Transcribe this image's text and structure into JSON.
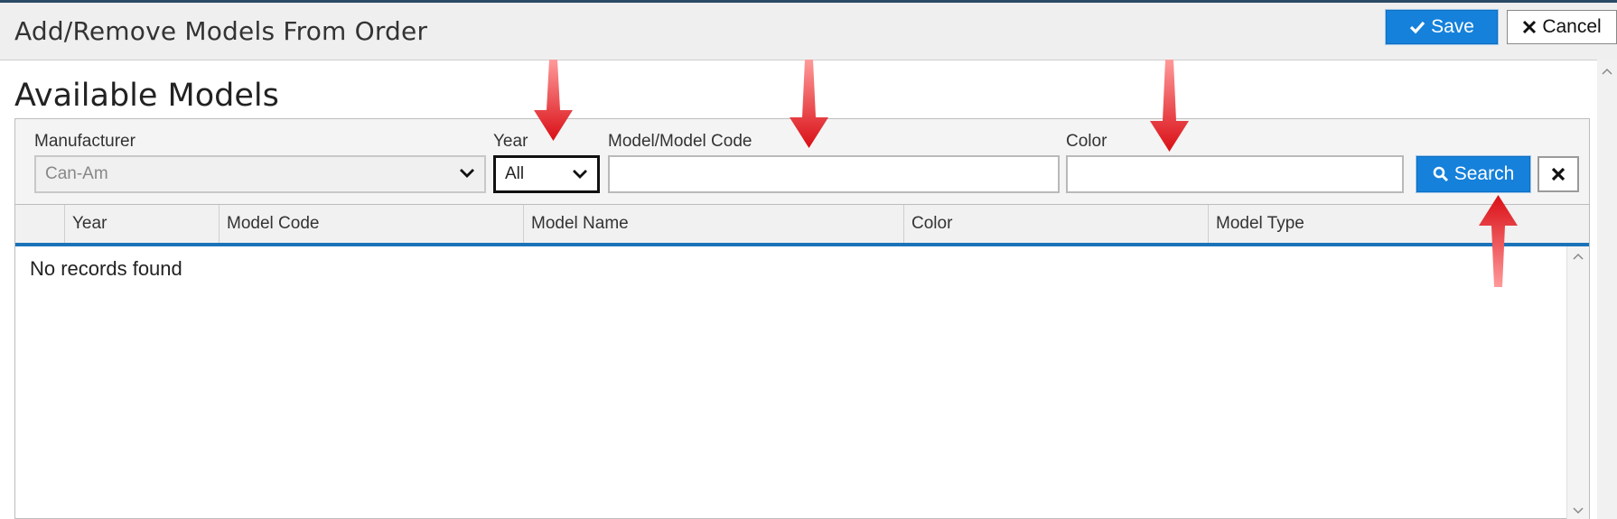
{
  "dialog": {
    "title": "Add/Remove Models From Order"
  },
  "toolbar": {
    "save_label": "Save",
    "cancel_label": "Cancel"
  },
  "section": {
    "title": "Available Models"
  },
  "filters": {
    "manufacturer": {
      "label": "Manufacturer",
      "value": "Can-Am"
    },
    "year": {
      "label": "Year",
      "value": "All"
    },
    "model_code": {
      "label": "Model/Model Code",
      "value": ""
    },
    "color": {
      "label": "Color",
      "value": ""
    },
    "search_label": "Search"
  },
  "grid": {
    "columns": [
      "Year",
      "Model Code",
      "Model Name",
      "Color",
      "Model Type"
    ],
    "empty_message": "No records found"
  },
  "colors": {
    "accent": "#1581db",
    "header_rule": "#1a73b8",
    "annotation_arrow": "#e3191f"
  },
  "icons": [
    "check-icon",
    "close-icon",
    "chevron-down-icon",
    "search-icon",
    "clear-x-icon",
    "scroll-up-icon",
    "scroll-down-icon"
  ]
}
